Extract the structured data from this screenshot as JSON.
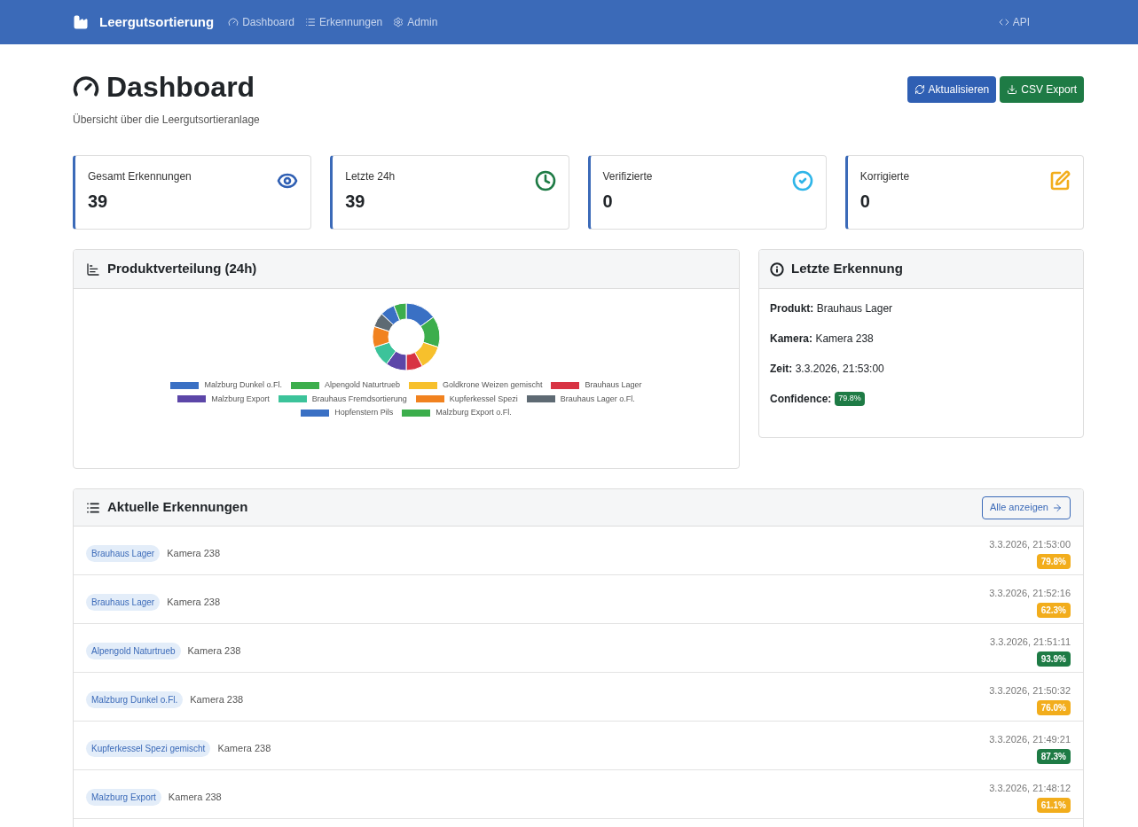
{
  "navbar": {
    "brand": "Leergutsortierung",
    "items": [
      {
        "label": "Dashboard",
        "kind": "gauge"
      },
      {
        "label": "Erkennungen",
        "kind": "list"
      },
      {
        "label": "Admin",
        "kind": "gear"
      }
    ],
    "api_link": "API"
  },
  "header": {
    "title": "Dashboard",
    "subtitle": "Übersicht über die Leergutsortieranlage",
    "buttons": [
      {
        "label": "Aktualisieren",
        "kind": "primary"
      },
      {
        "label": "CSV Export",
        "kind": "success"
      }
    ]
  },
  "stats": [
    {
      "label": "Gesamt Erkennungen",
      "value": "39",
      "kind": "eye",
      "color": "#2f5fb3"
    },
    {
      "label": "Letzte 24h",
      "value": "39",
      "kind": "clock",
      "color": "#1e7b45"
    },
    {
      "label": "Verifizierte",
      "value": "0",
      "kind": "check",
      "color": "#2fb5e8"
    },
    {
      "label": "Korrigierte",
      "value": "0",
      "kind": "edit",
      "color": "#f2ad1c"
    }
  ],
  "distribution": {
    "title": "Produktverteilung (24h)",
    "legend": [
      {
        "label": "Malzburg Dunkel o.Fl.",
        "color": "#3a70c4"
      },
      {
        "label": "Alpengold Naturtrueb",
        "color": "#3cae4c"
      },
      {
        "label": "Goldkrone Weizen gemischt",
        "color": "#f7c02c"
      },
      {
        "label": "Brauhaus Lager",
        "color": "#d83343"
      },
      {
        "label": "Malzburg Export",
        "color": "#5c46a8"
      },
      {
        "label": "Brauhaus Fremdsortierung",
        "color": "#3cc39a"
      },
      {
        "label": "Kupferkessel Spezi",
        "color": "#f1821f"
      },
      {
        "label": "Brauhaus Lager o.Fl.",
        "color": "#5e6a73"
      },
      {
        "label": "Hopfenstern Pils",
        "color": "#3a70c4"
      },
      {
        "label": "Malzburg Export o.Fl.",
        "color": "#3cae4c"
      }
    ]
  },
  "latest": {
    "title": "Letzte Erkennung",
    "fields": [
      {
        "label": "Produkt:",
        "value": "Brauhaus Lager"
      },
      {
        "label": "Kamera:",
        "value": "Kamera 238"
      },
      {
        "label": "Zeit:",
        "value": "3.3.2026, 21:53:00"
      }
    ],
    "confidence_label": "Confidence:",
    "confidence": {
      "text": "79.8%",
      "kind": "success"
    }
  },
  "recent": {
    "title": "Aktuelle Erkennungen",
    "button": "Alle anzeigen",
    "rows": [
      {
        "product": "Brauhaus Lager",
        "camera": "Kamera 238",
        "time": "3.3.2026, 21:53:00",
        "confidence": "79.8%",
        "kind": "warning"
      },
      {
        "product": "Brauhaus Lager",
        "camera": "Kamera 238",
        "time": "3.3.2026, 21:52:16",
        "confidence": "62.3%",
        "kind": "warning"
      },
      {
        "product": "Alpengold Naturtrueb",
        "camera": "Kamera 238",
        "time": "3.3.2026, 21:51:11",
        "confidence": "93.9%",
        "kind": "success"
      },
      {
        "product": "Malzburg Dunkel o.Fl.",
        "camera": "Kamera 238",
        "time": "3.3.2026, 21:50:32",
        "confidence": "76.0%",
        "kind": "warning"
      },
      {
        "product": "Kupferkessel Spezi gemischt",
        "camera": "Kamera 238",
        "time": "3.3.2026, 21:49:21",
        "confidence": "87.3%",
        "kind": "success"
      },
      {
        "product": "Malzburg Export",
        "camera": "Kamera 238",
        "time": "3.3.2026, 21:48:12",
        "confidence": "61.1%",
        "kind": "warning"
      }
    ]
  }
}
